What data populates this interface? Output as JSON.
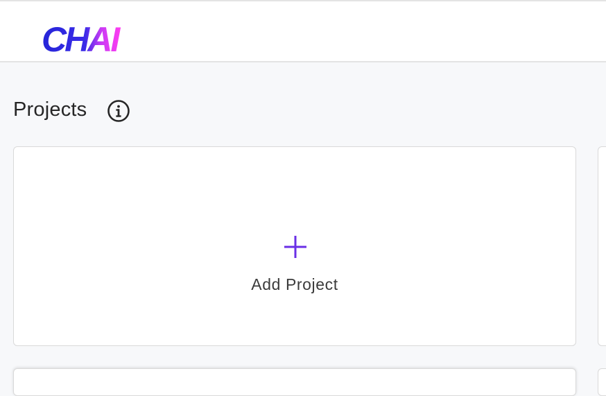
{
  "header": {
    "logo_text": "CHAI",
    "logo_colors": {
      "start": "#2a2ae0",
      "end": "#e23dff"
    }
  },
  "main": {
    "title": "Projects",
    "info_icon": "info-circle-icon",
    "add_card": {
      "label": "Add Project",
      "icon": "plus-icon",
      "accent_color": "#6a2fe6"
    }
  }
}
